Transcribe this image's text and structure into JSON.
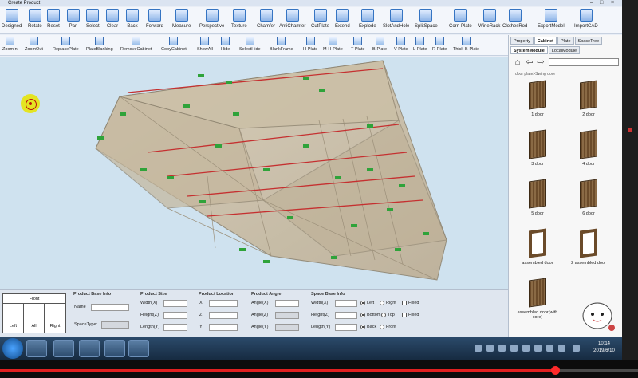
{
  "window": {
    "title": "Create Product"
  },
  "toolbar_main": [
    {
      "label": "Designed",
      "icon": "save-icon"
    },
    {
      "label": "Rotate",
      "icon": "rotate-icon"
    },
    {
      "label": "Reset",
      "icon": "reset-icon"
    },
    {
      "label": "Pan",
      "icon": "hand-icon"
    },
    {
      "label": "Select",
      "icon": "cursor-icon"
    },
    {
      "label": "Clear",
      "icon": "trash-icon"
    },
    {
      "label": "Back",
      "icon": "undo-icon"
    },
    {
      "label": "Forward",
      "icon": "redo-icon"
    },
    {
      "label": "Measure",
      "icon": "measure-icon"
    },
    {
      "label": "Perspective",
      "icon": "perspective-icon"
    },
    {
      "label": "Texture",
      "icon": "texture-icon"
    },
    {
      "label": "Chamfer",
      "icon": "chamfer-icon"
    },
    {
      "label": "AntiChamfer",
      "icon": "antichamfer-icon"
    },
    {
      "label": "CutPlate",
      "icon": "cut-plate-icon"
    },
    {
      "label": "Extend",
      "icon": "extend-icon"
    },
    {
      "label": "Explode",
      "icon": "explode-icon"
    },
    {
      "label": "SlotAndHole",
      "icon": "slot-icon"
    },
    {
      "label": "SplitSpace",
      "icon": "split-icon"
    },
    {
      "label": "Corn-Plate",
      "icon": "corner-plate-icon"
    },
    {
      "label": "WineRack",
      "icon": "wine-rack-icon"
    },
    {
      "label": "ClothesRod",
      "icon": "clothes-rod-icon"
    },
    {
      "label": "ExportModel",
      "icon": "export-icon"
    },
    {
      "label": "ImportCAD",
      "icon": "cad-icon"
    }
  ],
  "toolbar_secondary": [
    {
      "label": "ZoomIn",
      "icon": "zoom-in-icon"
    },
    {
      "label": "ZoomOut",
      "icon": "zoom-out-icon"
    },
    {
      "label": "ReplacePlate",
      "icon": "replace-plate-icon"
    },
    {
      "label": "PlateBlanking",
      "icon": "blanking-icon"
    },
    {
      "label": "RemoveCabinet",
      "icon": "remove-cabinet-icon"
    },
    {
      "label": "CopyCabinet",
      "icon": "copy-cabinet-icon"
    },
    {
      "label": "ShowAll",
      "icon": "eye-icon"
    },
    {
      "label": "Hide",
      "icon": "eye-hide-icon"
    },
    {
      "label": "SelectHide",
      "icon": "select-hide-icon"
    },
    {
      "label": "BlankFrame",
      "icon": "frame-icon"
    },
    {
      "label": "H-Plate",
      "icon": "plate-icon"
    },
    {
      "label": "M-H-Plate",
      "icon": "plate-icon"
    },
    {
      "label": "T-Plate",
      "icon": "plate-icon"
    },
    {
      "label": "B-Plate",
      "icon": "plate-icon"
    },
    {
      "label": "V-Plate",
      "icon": "plate-icon"
    },
    {
      "label": "L-Plate",
      "icon": "plate-icon"
    },
    {
      "label": "R-Plate",
      "icon": "plate-icon"
    },
    {
      "label": "Thick-B-Plate",
      "icon": "plate-icon"
    }
  ],
  "right_panel": {
    "tabs": [
      "Property",
      "Cabinet",
      "Plate",
      "SpaceTree"
    ],
    "active_tab": "Cabinet",
    "subtabs": [
      "SystemModule",
      "LocalModule"
    ],
    "breadcrumb": "door plate>Swing door",
    "search_value": "",
    "items": [
      {
        "label": "1 door",
        "kind": "door"
      },
      {
        "label": "2 door",
        "kind": "door"
      },
      {
        "label": "3 door",
        "kind": "door"
      },
      {
        "label": "4 door",
        "kind": "door"
      },
      {
        "label": "5 door",
        "kind": "door"
      },
      {
        "label": "6 door",
        "kind": "door"
      },
      {
        "label": "assembled door",
        "kind": "frame"
      },
      {
        "label": "2 assembled door",
        "kind": "frame"
      },
      {
        "label": "assembled door(with core)",
        "kind": "door"
      }
    ]
  },
  "front_box": {
    "title": "Front",
    "cells": [
      "Left",
      "All",
      "Right"
    ]
  },
  "product_base": {
    "title": "Product Base Info",
    "name_label": "Name",
    "space_type_label": "SpaceType:",
    "name_value": "",
    "space_type_value": ""
  },
  "product_size": {
    "title": "Product Size",
    "width": "Width(X)",
    "height": "Height(Z)",
    "length": "Length(Y)"
  },
  "product_location": {
    "title": "Product Location",
    "x": "X",
    "z": "Z",
    "y": "Y"
  },
  "product_angle": {
    "title": "Product Angle",
    "a1": "Angle(X)",
    "a2": "Angle(Z)",
    "a3": "Angle(Y)"
  },
  "space_base": {
    "title": "Space Base Info",
    "width": "Width(X)",
    "height": "Height(Z)",
    "length": "Length(Y)",
    "r1a": "Left",
    "r1b": "Right",
    "r1c": "Fixed",
    "r2a": "Bottom",
    "r2b": "Top",
    "r2c": "Fixed",
    "r3a": "Back",
    "r3b": "Front"
  },
  "taskbar": {
    "time": "10:14",
    "date": "2019/6/10"
  },
  "video_progress": 0.87
}
